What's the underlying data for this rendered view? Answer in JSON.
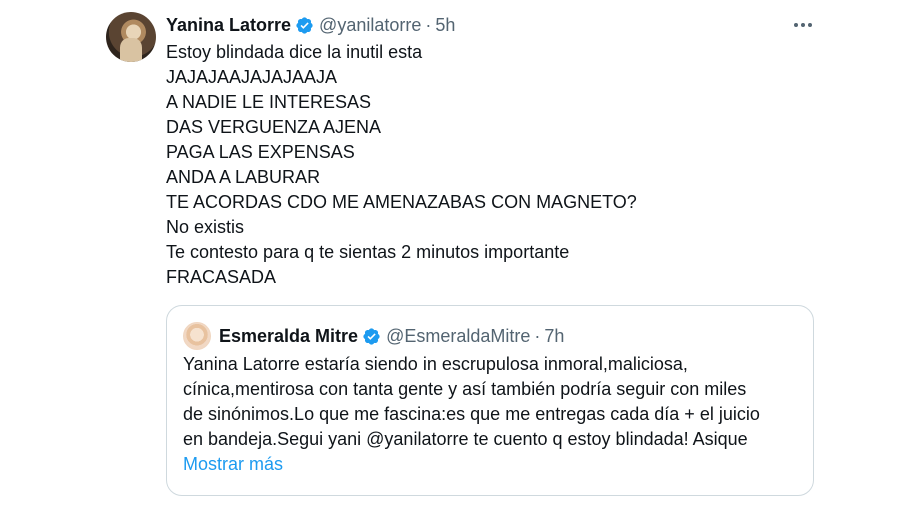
{
  "tweet": {
    "author_name": "Yanina Latorre",
    "handle": "@yanilatorre",
    "separator": "·",
    "time": "5h",
    "lines": [
      "Estoy blindada dice la inutil esta",
      "JAJAJAAJAJAJAAJA",
      "A NADIE LE INTERESAS",
      "DAS VERGUENZA AJENA",
      "PAGA LAS EXPENSAS",
      "ANDA A LABURAR",
      "TE ACORDAS CDO ME AMENAZABAS CON MAGNETO?",
      "No existis",
      "Te contesto para q te sientas 2 minutos importante",
      "FRACASADA"
    ]
  },
  "quoted": {
    "author_name": "Esmeralda Mitre",
    "handle": "@EsmeraldaMitre",
    "separator": "·",
    "time": "7h",
    "lines": [
      "Yanina Latorre estaría  siendo in escrupulosa inmoral,maliciosa,",
      "cínica,mentirosa con tanta gente y así también podría seguir con miles",
      "de sinónimos.Lo que me fascina:es que me entregas cada día + el juicio",
      "en bandeja.Segui  yani  @yanilatorre te cuento q estoy  blindada! Asique"
    ],
    "show_more": "Mostrar más"
  },
  "icons": {
    "verified": "verified-badge-icon",
    "more": "more-horizontal-icon"
  },
  "colors": {
    "verified": "#1d9bf0",
    "link": "#1d9bf0",
    "secondary_text": "#536471",
    "border": "#cfd9de"
  }
}
